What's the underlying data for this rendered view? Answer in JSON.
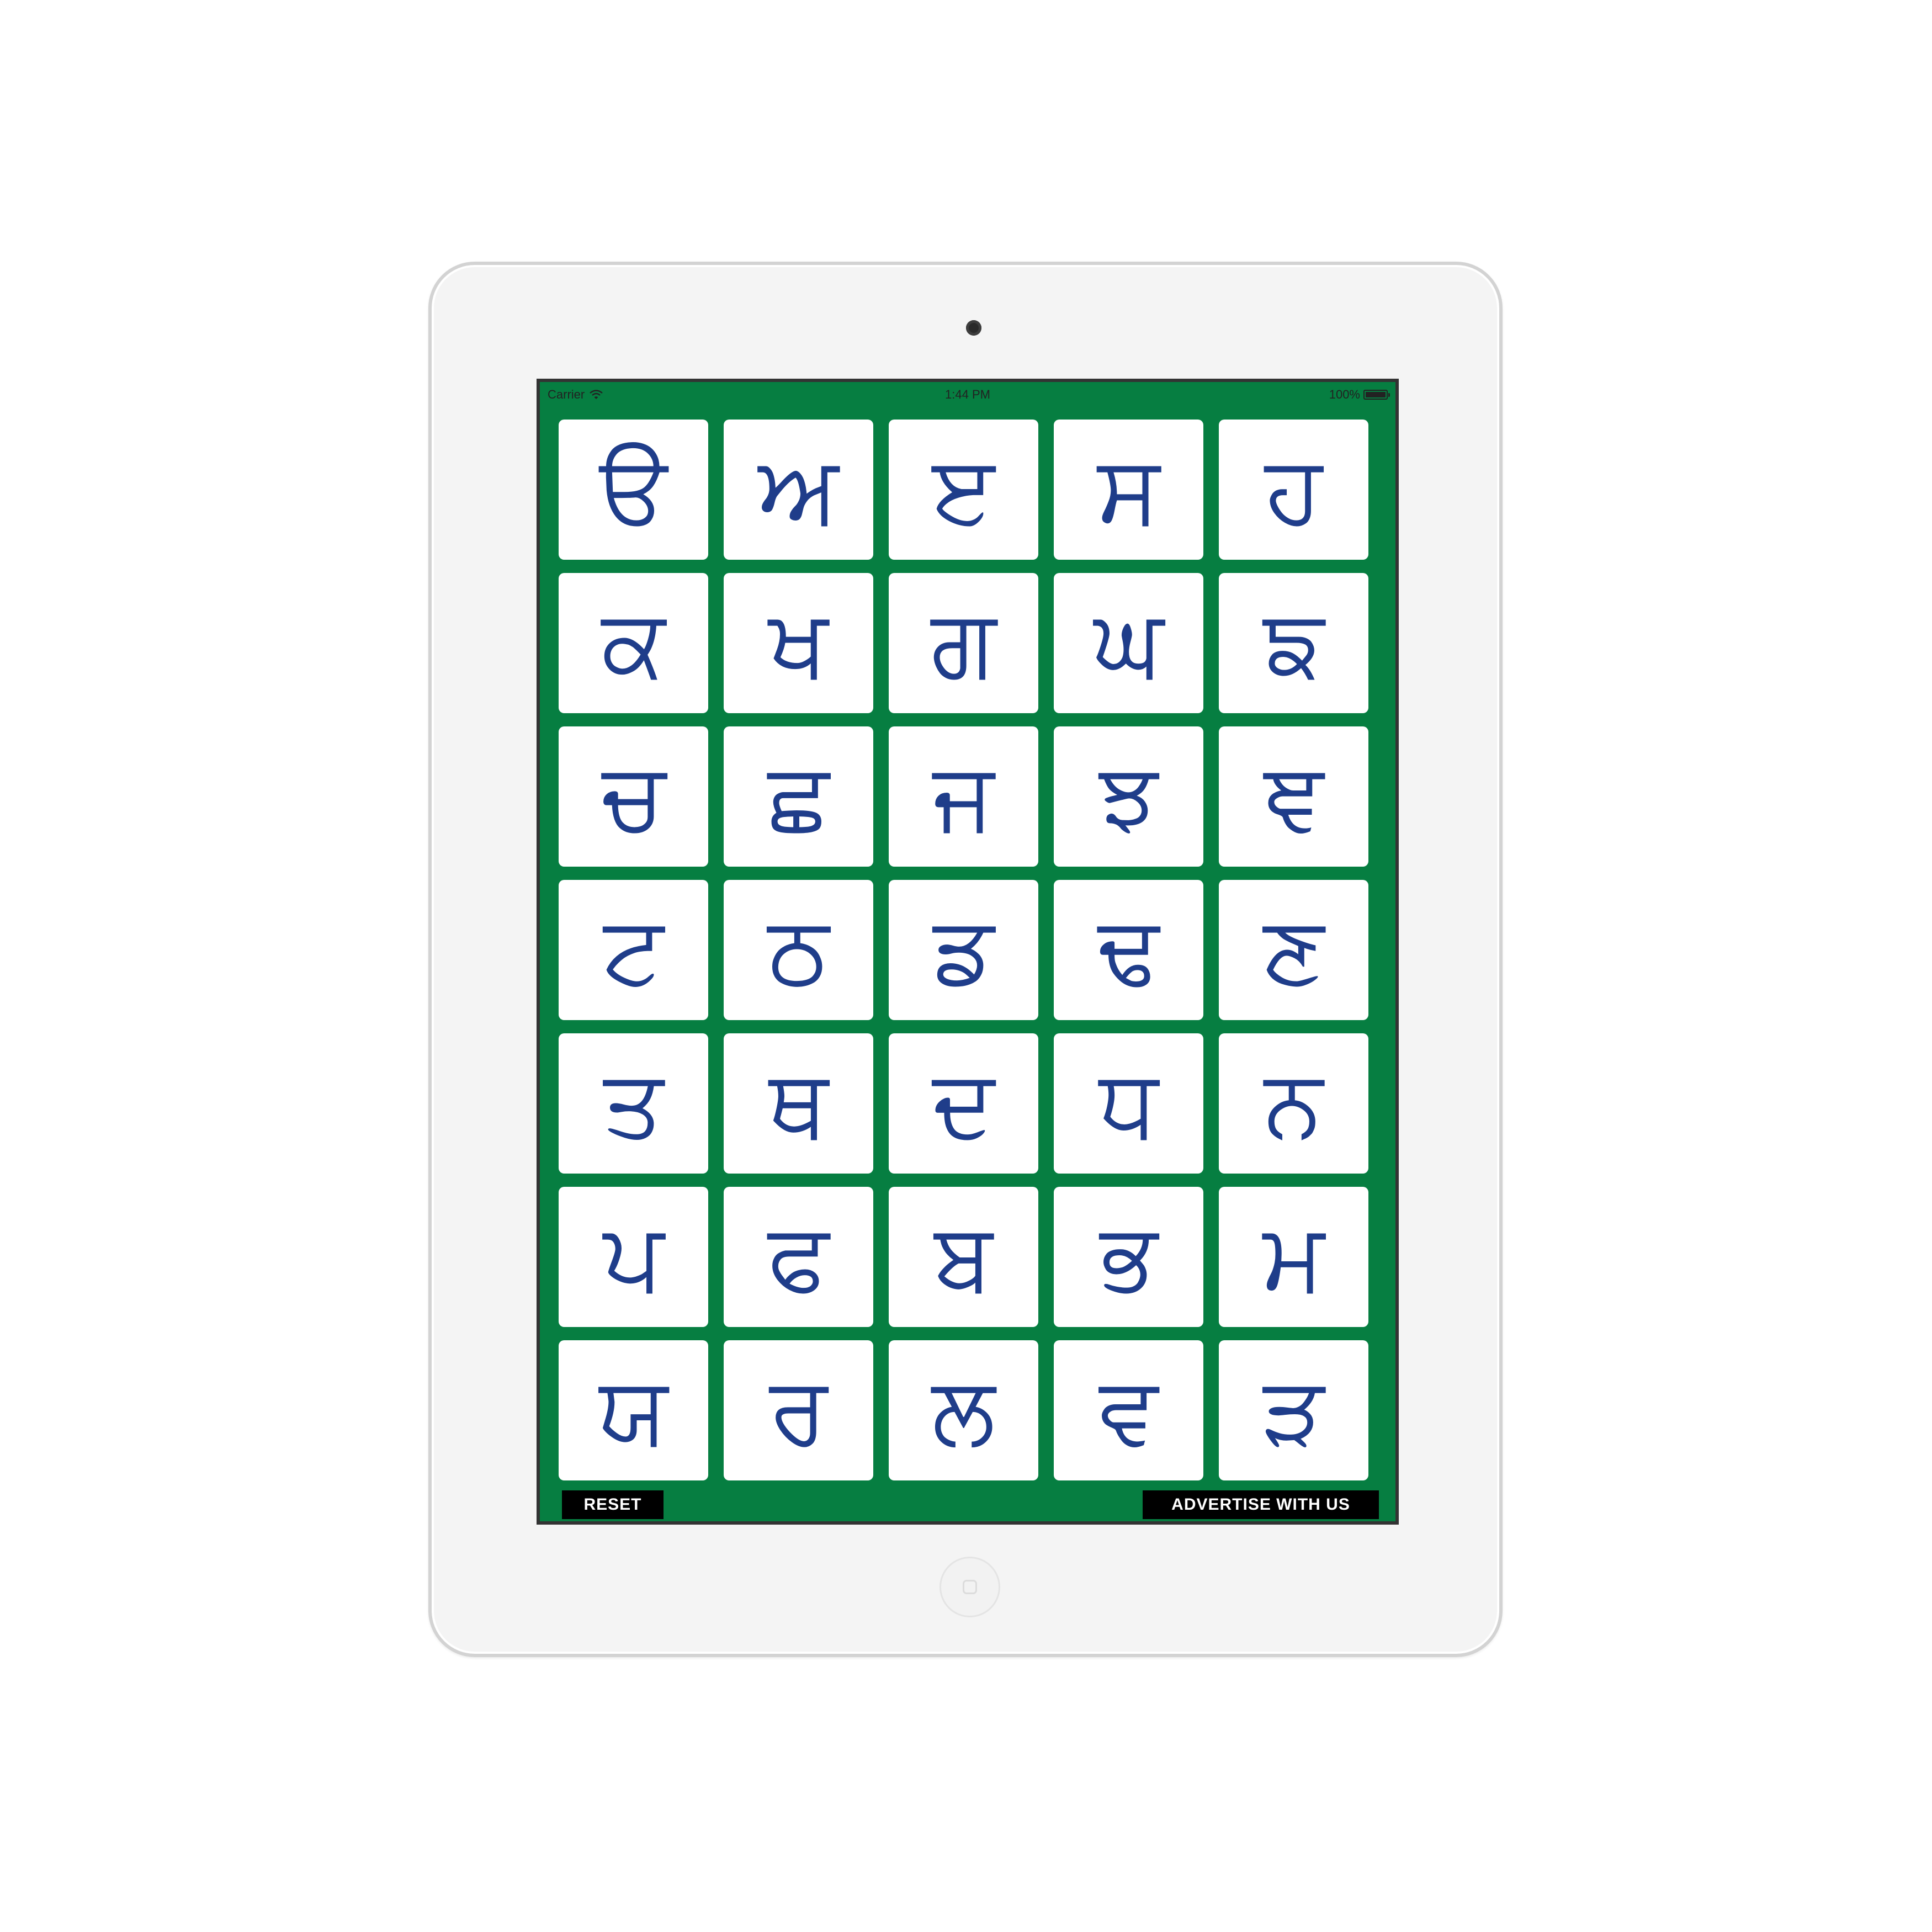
{
  "status_bar": {
    "carrier": "Carrier",
    "time": "1:44 PM",
    "battery_label": "100%",
    "battery_level": 1.0
  },
  "letters": [
    "ੳ",
    "ਅ",
    "ੲ",
    "ਸ",
    "ਹ",
    "ਕ",
    "ਖ",
    "ਗ",
    "ਘ",
    "ਙ",
    "ਚ",
    "ਛ",
    "ਜ",
    "ਝ",
    "ਞ",
    "ਟ",
    "ਠ",
    "ਡ",
    "ਢ",
    "ਣ",
    "ਤ",
    "ਥ",
    "ਦ",
    "ਧ",
    "ਨ",
    "ਪ",
    "ਫ",
    "ਬ",
    "ਭ",
    "ਮ",
    "ਯ",
    "ਰ",
    "ਲ",
    "ਵ",
    "ੜ"
  ],
  "buttons": {
    "reset": "RESET",
    "advertise": "ADVERTISE WITH US"
  },
  "colors": {
    "screen_background": "#067e41",
    "letter": "#1f3d8a",
    "tile": "#ffffff",
    "button_background": "#000000",
    "button_text": "#ffffff"
  },
  "icons": {
    "wifi": "wifi-icon",
    "battery": "battery-icon",
    "camera": "camera-icon",
    "home": "home-button"
  }
}
